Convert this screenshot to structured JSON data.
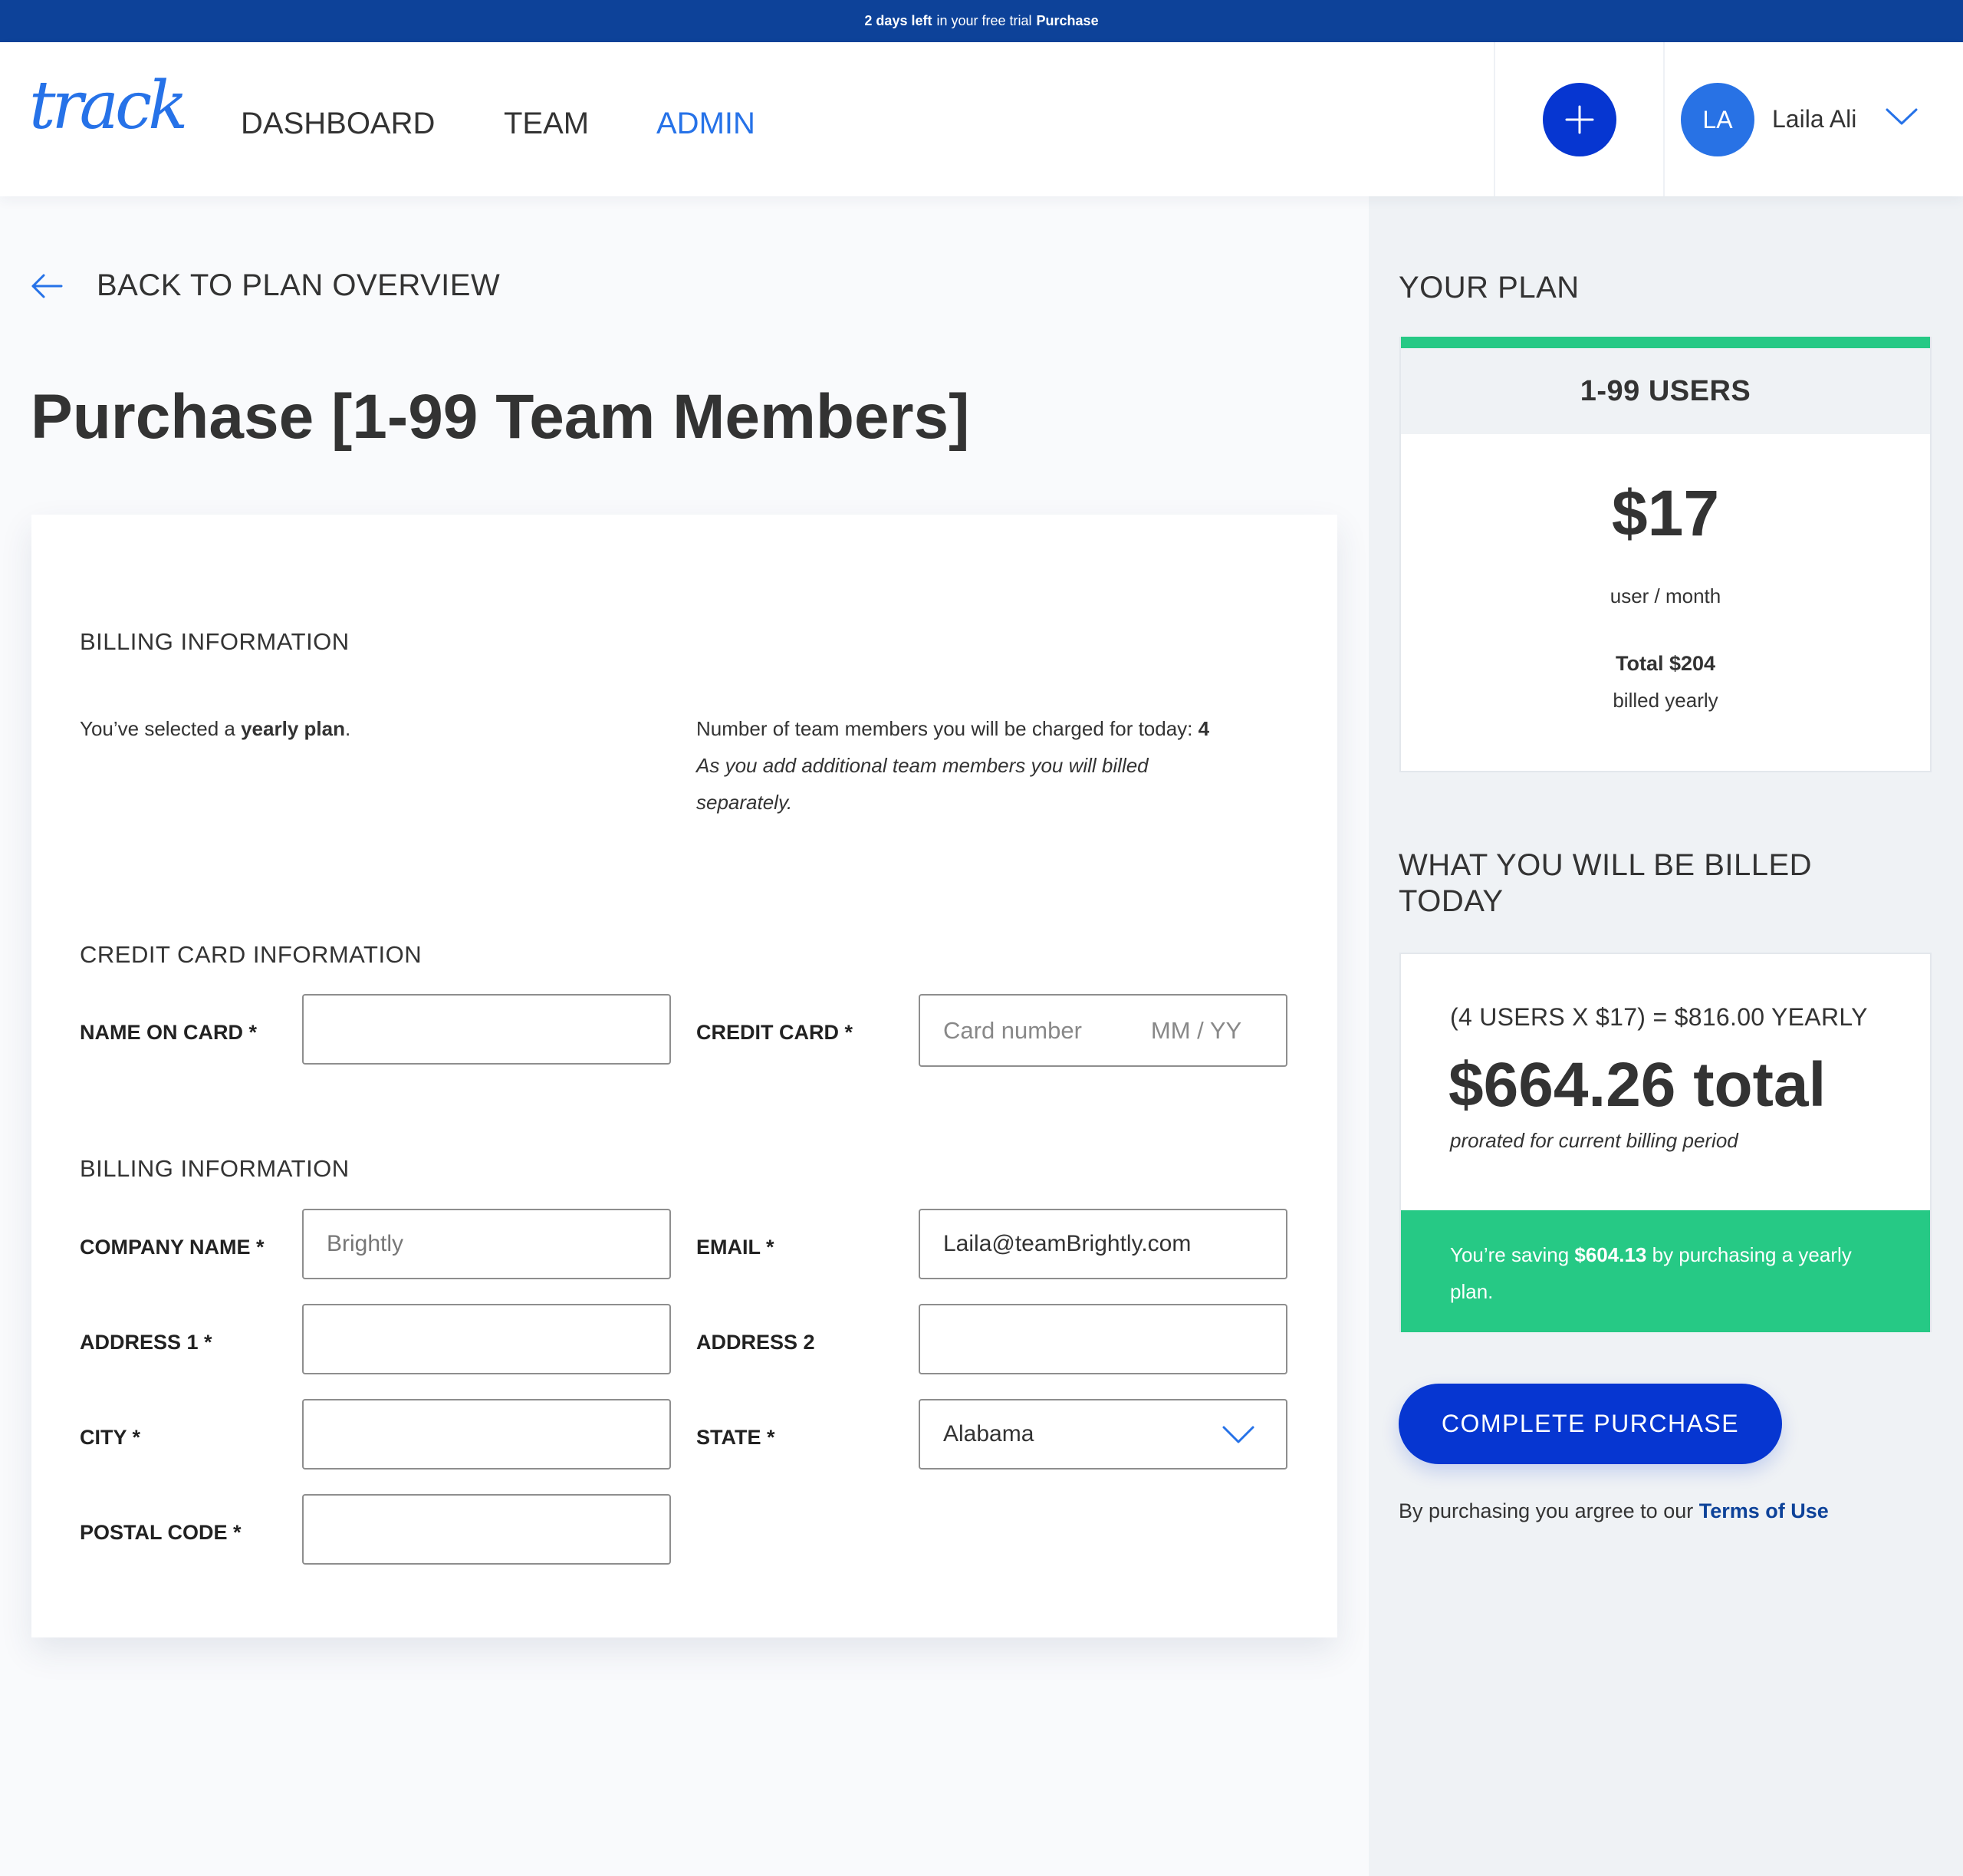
{
  "banner": {
    "days_left": "2 days left",
    "trial_text": "in your free trial",
    "purchase_link": "Purchase"
  },
  "header": {
    "logo": "track",
    "nav": [
      {
        "label": "DASHBOARD",
        "active": false
      },
      {
        "label": "TEAM",
        "active": false
      },
      {
        "label": "ADMIN",
        "active": true
      }
    ],
    "add_button_icon": "plus-icon",
    "user": {
      "initials": "LA",
      "name": "Laila Ali",
      "menu_icon": "chevron-down-icon"
    }
  },
  "colors": {
    "banner": "#0D4299",
    "accent": "#2672E8",
    "primary_button": "#0636D1",
    "success": "#26C985",
    "link": "#0D4299"
  },
  "back_link": {
    "icon": "arrow-left-icon",
    "label": "BACK TO PLAN OVERVIEW"
  },
  "page_title": "Purchase [1-99 Team Members]",
  "form": {
    "plan_section": {
      "heading": "BILLING INFORMATION",
      "selected_prefix": "You’ve selected a",
      "selected_plan": "yearly plan",
      "selected_suffix": ".",
      "members_text": "Number of team members you will be charged for today:",
      "members_count": "4",
      "additional_note": "As you add additional team members you will billed separately."
    },
    "card_section": {
      "heading": "CREDIT CARD INFORMATION",
      "name_label": "NAME ON CARD *",
      "name_value": "",
      "card_label": "CREDIT CARD *",
      "card_placeholder": "Card number",
      "expiry_placeholder": "MM / YY"
    },
    "billing_section": {
      "heading": "BILLING INFORMATION",
      "company_label": "COMPANY NAME *",
      "company_value": "Brightly",
      "email_label": "EMAIL *",
      "email_value": "Laila@teamBrightly.com",
      "address1_label": "ADDRESS 1 *",
      "address1_value": "",
      "address2_label": "ADDRESS 2",
      "address2_value": "",
      "city_label": "CITY *",
      "city_value": "",
      "state_label": "STATE *",
      "state_value": "Alabama",
      "postal_label": "POSTAL CODE *",
      "postal_value": ""
    }
  },
  "sidebar": {
    "plan_heading": "YOUR PLAN",
    "plan": {
      "tier": "1-99 USERS",
      "price": "$17",
      "unit": "user / month",
      "total": "Total $204",
      "billing": "billed yearly"
    },
    "billed_heading_line1": "WHAT YOU WILL BE BILLED",
    "billed_heading_line2": "TODAY",
    "bill": {
      "formula": "(4 USERS X $17) = $816.00 YEARLY",
      "total": "$664.26 total",
      "note": "prorated for current billing period",
      "saving_prefix": "You’re saving",
      "saving_amount": "$604.13",
      "saving_suffix": "by purchasing a yearly plan."
    },
    "complete_button": "COMPLETE PURCHASE",
    "terms_prefix": "By purchasing you argree to our",
    "terms_link": "Terms of Use"
  }
}
